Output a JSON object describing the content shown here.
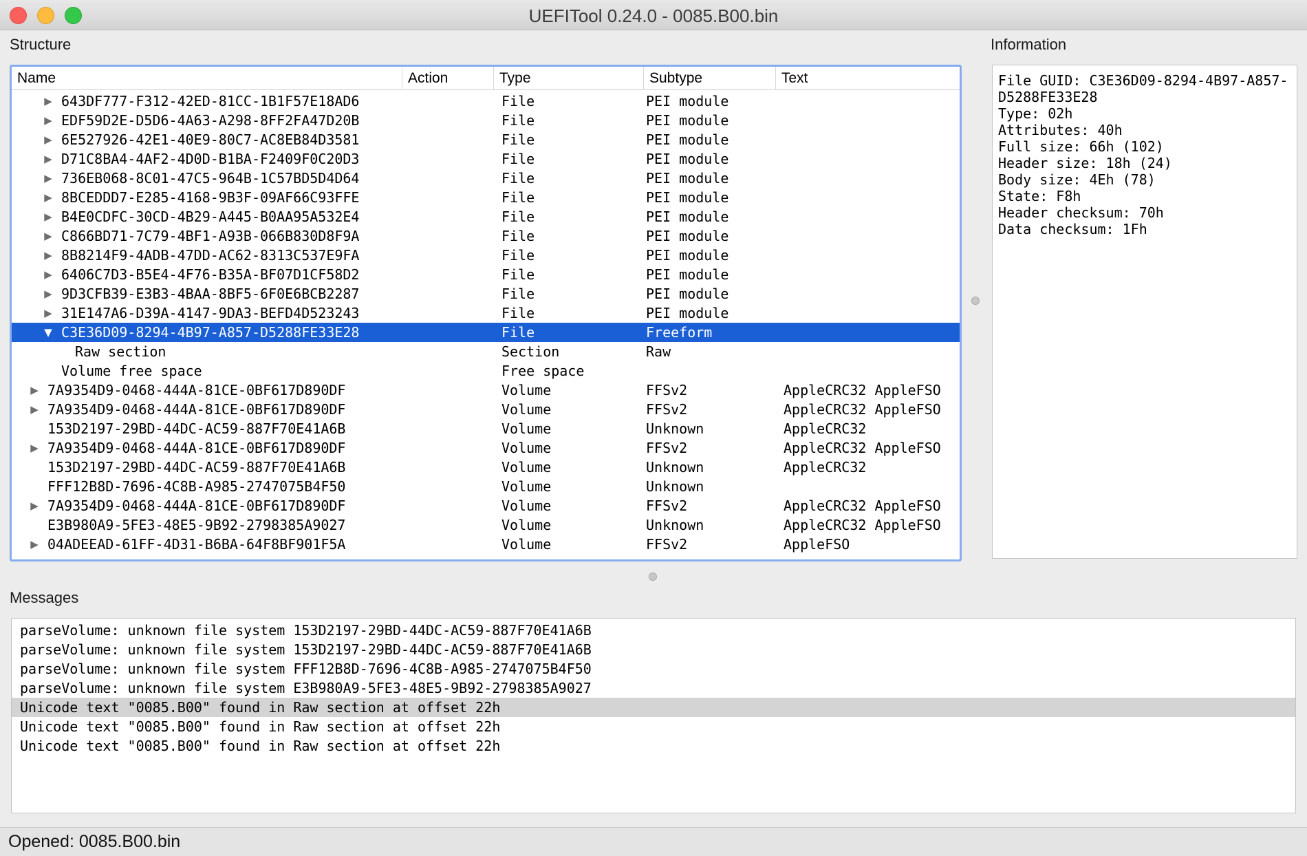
{
  "window": {
    "title": "UEFITool 0.24.0 - 0085.B00.bin"
  },
  "structure": {
    "label": "Structure",
    "columns": [
      "Name",
      "Action",
      "Type",
      "Subtype",
      "Text"
    ],
    "rows": [
      {
        "name": "643DF777-F312-42ED-81CC-1B1F57E18AD6",
        "type": "File",
        "subtype": "PEI module",
        "text": ""
      },
      {
        "name": "EDF59D2E-D5D6-4A63-A298-8FF2FA47D20B",
        "type": "File",
        "subtype": "PEI module",
        "text": ""
      },
      {
        "name": "6E527926-42E1-40E9-80C7-AC8EB84D3581",
        "type": "File",
        "subtype": "PEI module",
        "text": ""
      },
      {
        "name": "D71C8BA4-4AF2-4D0D-B1BA-F2409F0C20D3",
        "type": "File",
        "subtype": "PEI module",
        "text": ""
      },
      {
        "name": "736EB068-8C01-47C5-964B-1C57BD5D4D64",
        "type": "File",
        "subtype": "PEI module",
        "text": ""
      },
      {
        "name": "8BCEDDD7-E285-4168-9B3F-09AF66C93FFE",
        "type": "File",
        "subtype": "PEI module",
        "text": ""
      },
      {
        "name": "B4E0CDFC-30CD-4B29-A445-B0AA95A532E4",
        "type": "File",
        "subtype": "PEI module",
        "text": ""
      },
      {
        "name": "C866BD71-7C79-4BF1-A93B-066B830D8F9A",
        "type": "File",
        "subtype": "PEI module",
        "text": ""
      },
      {
        "name": "8B8214F9-4ADB-47DD-AC62-8313C537E9FA",
        "type": "File",
        "subtype": "PEI module",
        "text": ""
      },
      {
        "name": "6406C7D3-B5E4-4F76-B35A-BF07D1CF58D2",
        "type": "File",
        "subtype": "PEI module",
        "text": ""
      },
      {
        "name": "9D3CFB39-E3B3-4BAA-8BF5-6F0E6BCB2287",
        "type": "File",
        "subtype": "PEI module",
        "text": ""
      },
      {
        "name": "31E147A6-D39A-4147-9DA3-BEFD4D523243",
        "type": "File",
        "subtype": "PEI module",
        "text": ""
      },
      {
        "name": "C3E36D09-8294-4B97-A857-D5288FE33E28",
        "type": "File",
        "subtype": "Freeform",
        "text": ""
      },
      {
        "name": "Raw section",
        "type": "Section",
        "subtype": "Raw",
        "text": ""
      },
      {
        "name": "Volume free space",
        "type": "Free space",
        "subtype": "",
        "text": ""
      },
      {
        "name": "7A9354D9-0468-444A-81CE-0BF617D890DF",
        "type": "Volume",
        "subtype": "FFSv2",
        "text": "AppleCRC32 AppleFSO"
      },
      {
        "name": "7A9354D9-0468-444A-81CE-0BF617D890DF",
        "type": "Volume",
        "subtype": "FFSv2",
        "text": "AppleCRC32 AppleFSO"
      },
      {
        "name": "153D2197-29BD-44DC-AC59-887F70E41A6B",
        "type": "Volume",
        "subtype": "Unknown",
        "text": "AppleCRC32"
      },
      {
        "name": "7A9354D9-0468-444A-81CE-0BF617D890DF",
        "type": "Volume",
        "subtype": "FFSv2",
        "text": "AppleCRC32 AppleFSO"
      },
      {
        "name": "153D2197-29BD-44DC-AC59-887F70E41A6B",
        "type": "Volume",
        "subtype": "Unknown",
        "text": "AppleCRC32"
      },
      {
        "name": "FFF12B8D-7696-4C8B-A985-2747075B4F50",
        "type": "Volume",
        "subtype": "Unknown",
        "text": ""
      },
      {
        "name": "7A9354D9-0468-444A-81CE-0BF617D890DF",
        "type": "Volume",
        "subtype": "FFSv2",
        "text": "AppleCRC32 AppleFSO"
      },
      {
        "name": "E3B980A9-5FE3-48E5-9B92-2798385A9027",
        "type": "Volume",
        "subtype": "Unknown",
        "text": "AppleCRC32 AppleFSO"
      },
      {
        "name": "04ADEEAD-61FF-4D31-B6BA-64F8BF901F5A",
        "type": "Volume",
        "subtype": "FFSv2",
        "text": "AppleFSO"
      }
    ]
  },
  "information": {
    "label": "Information",
    "text": "File GUID: C3E36D09-8294-4B97-A857-D5288FE33E28\nType: 02h\nAttributes: 40h\nFull size: 66h (102)\nHeader size: 18h (24)\nBody size: 4Eh (78)\nState: F8h\nHeader checksum: 70h\nData checksum: 1Fh"
  },
  "messages": {
    "label": "Messages",
    "items": [
      "parseVolume: unknown file system 153D2197-29BD-44DC-AC59-887F70E41A6B",
      "parseVolume: unknown file system 153D2197-29BD-44DC-AC59-887F70E41A6B",
      "parseVolume: unknown file system FFF12B8D-7696-4C8B-A985-2747075B4F50",
      "parseVolume: unknown file system E3B980A9-5FE3-48E5-9B92-2798385A9027",
      "Unicode text \"0085.B00\" found in Raw section at offset 22h",
      "Unicode text \"0085.B00\" found in Raw section at offset 22h",
      "Unicode text \"0085.B00\" found in Raw section at offset 22h"
    ]
  },
  "status": {
    "text": "Opened: 0085.B00.bin"
  },
  "colors": {
    "selection": "#1a5fd6",
    "focus_ring": "#86acef",
    "message_highlight": "#d4d4d4"
  }
}
